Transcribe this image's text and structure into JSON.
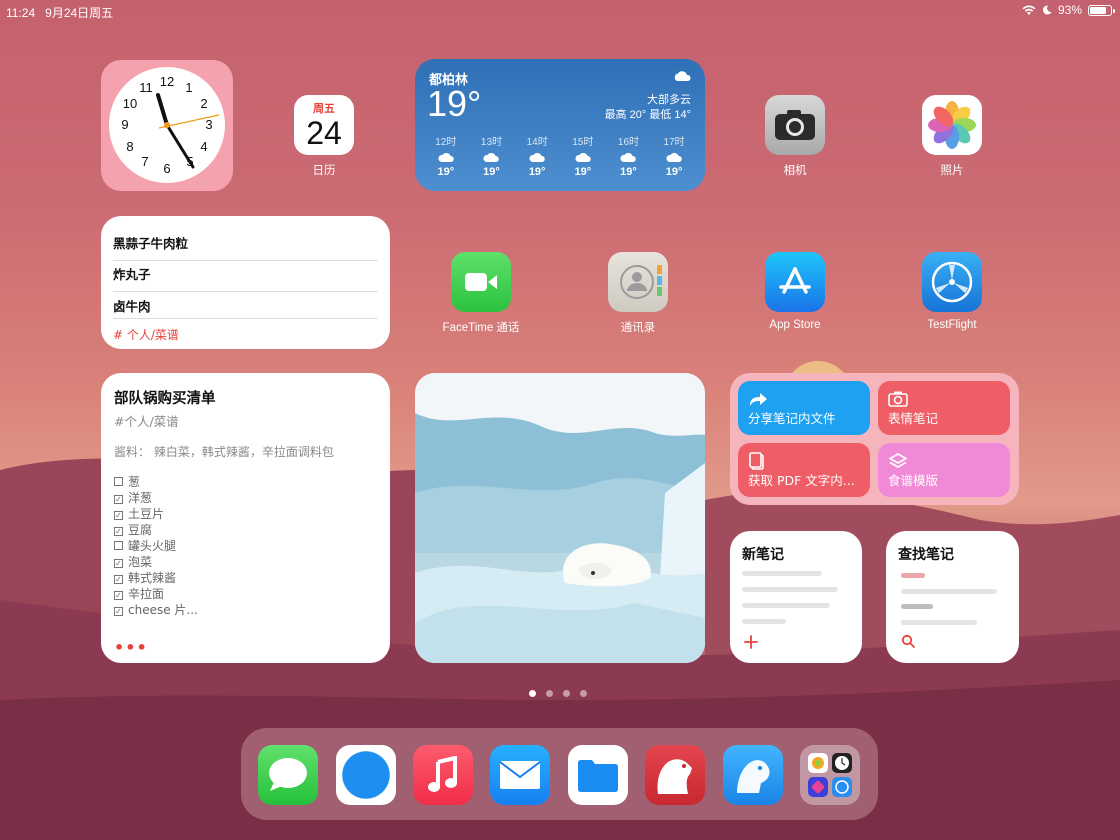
{
  "status_bar": {
    "time": "11:24",
    "date": "9月24日周五",
    "battery": "93%"
  },
  "calendar": {
    "weekday": "周五",
    "day": "24",
    "label": "日历"
  },
  "weather": {
    "city": "都柏林",
    "temp": "19°",
    "condition": "大部多云",
    "high_low": "最高 20° 最低 14°",
    "hours": [
      {
        "time": "12时",
        "temp": "19°"
      },
      {
        "time": "13时",
        "temp": "19°"
      },
      {
        "time": "14时",
        "temp": "19°"
      },
      {
        "time": "15时",
        "temp": "19°"
      },
      {
        "time": "16时",
        "temp": "19°"
      },
      {
        "time": "17时",
        "temp": "19°"
      }
    ]
  },
  "apps": {
    "camera": "相机",
    "photos": "照片",
    "facetime": "FaceTime 通话",
    "contacts": "通讯录",
    "appstore": "App Store",
    "testflight": "TestFlight"
  },
  "notes_list": {
    "items": [
      "黑蒜子牛肉粒",
      "炸丸子",
      "卤牛肉"
    ],
    "tag": "# 个人/菜谱"
  },
  "shopping": {
    "title": "部队锅购买清单",
    "tag": "#个人/菜谱",
    "sauce": "酱料： 辣白菜，韩式辣酱，辛拉面调料包",
    "items": [
      {
        "text": "葱",
        "checked": false
      },
      {
        "text": "洋葱",
        "checked": true
      },
      {
        "text": "土豆片",
        "checked": true
      },
      {
        "text": "豆腐",
        "checked": true
      },
      {
        "text": "罐头火腿",
        "checked": false
      },
      {
        "text": "泡菜",
        "checked": true
      },
      {
        "text": "韩式辣酱",
        "checked": true
      },
      {
        "text": "辛拉面",
        "checked": true
      },
      {
        "text": "cheese 片...",
        "checked": true
      }
    ],
    "more": "•••"
  },
  "shortcuts": {
    "share": "分享笔记内文件",
    "emoji": "表情笔记",
    "pdf": "获取 PDF 文字内...",
    "recipe": "食谱模版"
  },
  "new_note": {
    "title": "新笔记"
  },
  "find_note": {
    "title": "查找笔记"
  },
  "page": {
    "count": 4,
    "current": 1
  },
  "colors": {
    "accent_red": "#e5433b",
    "weather_blue": "#2f6fb6",
    "shortcut_blue": "#1ea1f1",
    "shortcut_red": "#ef5e66",
    "shortcut_pink": "#f08ad6"
  },
  "dock": [
    "messages-icon",
    "safari-icon",
    "music-icon",
    "mail-icon",
    "files-icon",
    "bear-icon",
    "day-one-icon",
    "app-library-icon"
  ]
}
